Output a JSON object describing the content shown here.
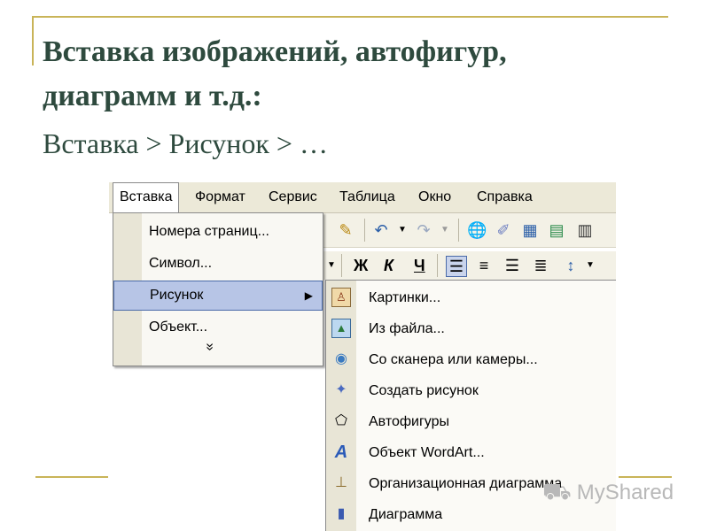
{
  "slide": {
    "title_line1": "Вставка изображений, автофигур,",
    "title_line2": "диаграмм и т.д.:",
    "subtitle": "Вставка > Рисунок > …"
  },
  "menubar": {
    "items": [
      "Вставка",
      "Формат",
      "Сервис",
      "Таблица",
      "Окно",
      "Справка"
    ]
  },
  "toolbar": {
    "bold": "Ж",
    "italic": "К",
    "underline": "Ч",
    "icons": [
      "format-painter-icon",
      "undo-icon",
      "redo-icon",
      "hyperlink-icon",
      "drawing-icon",
      "table-icon",
      "excel-icon",
      "columns-icon",
      "align-left-icon",
      "align-center-icon",
      "align-right-icon",
      "justify-icon",
      "line-spacing-icon"
    ]
  },
  "insert_menu": {
    "items": [
      {
        "label": "Номера страниц..."
      },
      {
        "label": "Символ..."
      },
      {
        "label": "Рисунок",
        "submenu": true
      },
      {
        "label": "Объект..."
      }
    ],
    "more": "»"
  },
  "picture_submenu": {
    "items": [
      {
        "label": "Картинки...",
        "icon": "clipart-icon"
      },
      {
        "label": "Из файла...",
        "icon": "picture-file-icon"
      },
      {
        "label": "Со сканера или камеры...",
        "icon": "scanner-icon"
      },
      {
        "label": "Создать рисунок",
        "icon": "new-drawing-icon"
      },
      {
        "label": "Автофигуры",
        "icon": "autoshapes-icon"
      },
      {
        "label": "Объект WordArt...",
        "icon": "wordart-icon"
      },
      {
        "label": "Организационная диаграмма",
        "icon": "org-chart-icon"
      },
      {
        "label": "Диаграмма",
        "icon": "chart-icon"
      }
    ]
  },
  "watermark": {
    "text": "MyShared"
  },
  "colors": {
    "accent_rule": "#c9b458",
    "title": "#2e4a3e",
    "highlight": "#b7c5e6"
  }
}
